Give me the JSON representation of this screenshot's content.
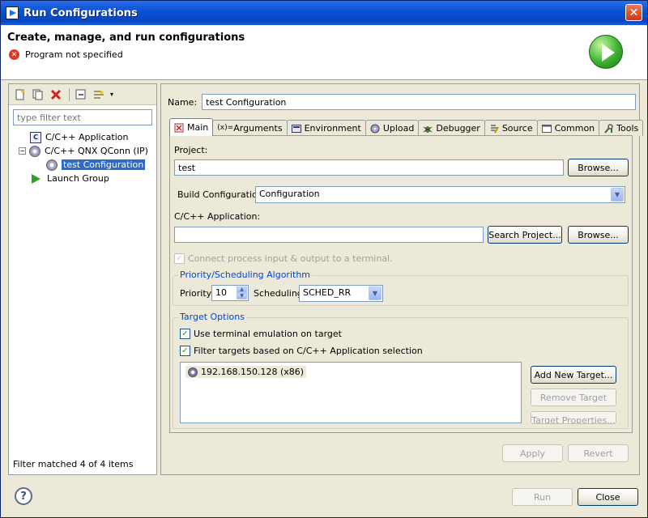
{
  "window": {
    "title": "Run Configurations",
    "close_glyph": "✕"
  },
  "header": {
    "title": "Create, manage, and run configurations",
    "message": "Program not specified",
    "error_glyph": "✕"
  },
  "left": {
    "filter_placeholder": "type filter text",
    "tree": [
      {
        "label": "C/C++ Application",
        "icon": "c-app-icon"
      },
      {
        "label": "C/C++ QNX QConn (IP)",
        "icon": "disk-icon",
        "expander": "−"
      },
      {
        "label": "test Configuration",
        "icon": "disk-icon",
        "selected": true
      },
      {
        "label": "Launch Group",
        "icon": "play-icon"
      }
    ],
    "status": "Filter matched 4 of 4 items"
  },
  "config": {
    "name_label": "Name:",
    "name_value": "test Configuration",
    "tabs": [
      {
        "label": "Main",
        "active": true
      },
      {
        "label": "Arguments"
      },
      {
        "label": "Environment"
      },
      {
        "label": "Upload"
      },
      {
        "label": "Debugger"
      },
      {
        "label": "Source"
      },
      {
        "label": "Common"
      },
      {
        "label": "Tools"
      }
    ],
    "project_label": "Project:",
    "project_value": "test",
    "browse_label": "Browse...",
    "build_config_label": "Build Configuration",
    "build_config_value": "Configuration",
    "app_label": "C/C++ Application:",
    "app_value": "",
    "search_project_label": "Search Project...",
    "connect_label": "Connect process input & output to a terminal.",
    "priority_group": "Priority/Scheduling Algorithm",
    "priority_label": "Priority",
    "priority_value": "10",
    "scheduling_label": "Scheduling",
    "scheduling_value": "SCHED_RR",
    "target_group": "Target Options",
    "use_terminal_label": "Use terminal emulation on target",
    "filter_targets_label": "Filter targets based on C/C++ Application selection",
    "target_item": "192.168.150.128 (x86)",
    "add_target_label": "Add New Target...",
    "remove_target_label": "Remove Target",
    "target_props_label": "Target Properties...",
    "apply_label": "Apply",
    "revert_label": "Revert"
  },
  "footer": {
    "help": "?",
    "run_label": "Run",
    "close_label": "Close"
  },
  "colors": {
    "accent": "#316ac5",
    "titlebar": "#0a52d6"
  }
}
